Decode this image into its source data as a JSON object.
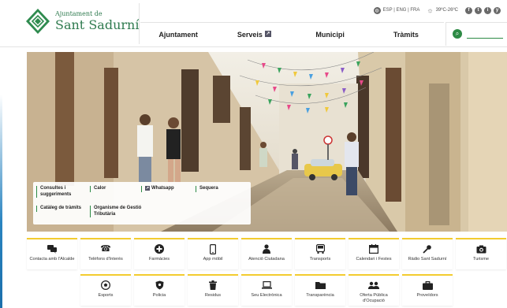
{
  "logo": {
    "line1": "Ajuntament de",
    "line2": "Sant Sadurní"
  },
  "utility": {
    "languages": "ESP | ENG | FRA",
    "weather": "39ºC-26ºC",
    "social": [
      "f",
      "t",
      "i",
      "y"
    ]
  },
  "nav": {
    "items": [
      "Ajuntament",
      "Serveis",
      "Municipi",
      "Tràmits"
    ]
  },
  "search": {
    "placeholder": ""
  },
  "quick_links": {
    "consultes": "Consultes i suggeriments",
    "calor": "Calor",
    "whatsapp": "Whatsapp",
    "sequera": "Sequera",
    "cataleg": "Catàleg de tràmits",
    "organisme": "Organisme de Gestió Tributària"
  },
  "tiles_row1": [
    {
      "label": "Contacta amb l'Alcalde",
      "icon": "chat-icon"
    },
    {
      "label": "Telèfons d'Interès",
      "icon": "phone-icon"
    },
    {
      "label": "Farmàcies",
      "icon": "pharmacy-icon"
    },
    {
      "label": "App mòbil",
      "icon": "mobile-icon"
    },
    {
      "label": "Atenció Ciutadana",
      "icon": "citizen-icon"
    },
    {
      "label": "Transports",
      "icon": "bus-icon"
    },
    {
      "label": "Calendari i Festes",
      "icon": "calendar-icon"
    },
    {
      "label": "Ràdio Sant Sadurní",
      "icon": "radio-icon"
    },
    {
      "label": "Turisme",
      "icon": "camera-icon"
    }
  ],
  "tiles_row2": [
    {
      "label": "Esports",
      "icon": "ball-icon"
    },
    {
      "label": "Policia",
      "icon": "shield-icon"
    },
    {
      "label": "Residus",
      "icon": "trash-icon"
    },
    {
      "label": "Seu Electrònica",
      "icon": "laptop-icon"
    },
    {
      "label": "Transparència",
      "icon": "folder-icon"
    },
    {
      "label": "Oferta Pública d'Ocupació",
      "icon": "people-icon"
    },
    {
      "label": "Proveïdors",
      "icon": "briefcase-icon"
    }
  ],
  "colors": {
    "brand_green": "#2d8a45",
    "tile_accent": "#f3cc2f"
  }
}
